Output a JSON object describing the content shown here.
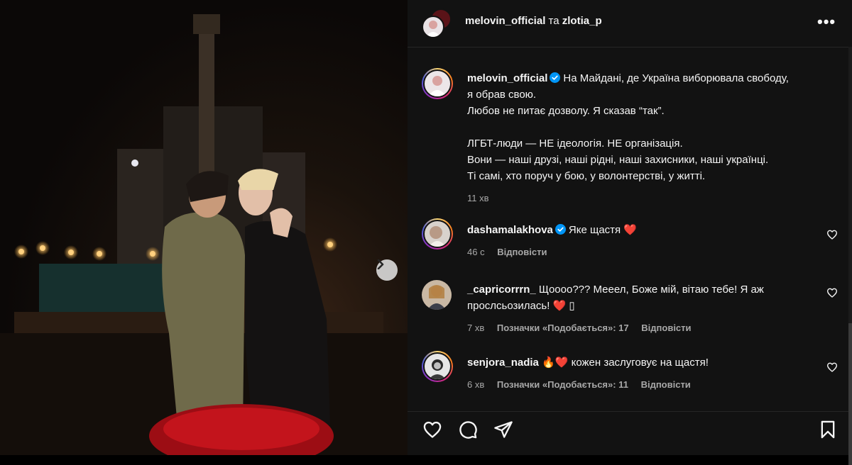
{
  "header": {
    "user1": "melovin_official",
    "joiner": "та",
    "user2": "zlotia_p"
  },
  "post": {
    "username": "melovin_official",
    "caption_lines": [
      "На Майдані, де Україна виборювала свободу,",
      "я обрав свою.",
      "Любов не питає дозволу. Я сказав “так”.",
      "",
      "ЛГБТ-люди — НЕ ідеологія. НЕ організація.",
      "Вони — наші друзі, наші рідні, наші захисники, наші українці.",
      "Ті самі, хто поруч у бою, у волонтерстві, у житті."
    ],
    "time": "11 хв"
  },
  "comments": [
    {
      "username": "dashamalakhova",
      "verified": true,
      "text": "Яке щастя",
      "emoji": "❤️",
      "time": "46 с",
      "likes": "",
      "reply": "Відповісти"
    },
    {
      "username": "_capricorrrn_",
      "verified": false,
      "text": "Щоооо??? Мееел, Боже мій, вітаю тебе! Я аж",
      "text2": "прослсьозилась! ❤️ ▯",
      "time": "7 хв",
      "likes": "Позначки «Подобається»: 17",
      "reply": "Відповісти"
    },
    {
      "username": "senjora_nadia",
      "verified": false,
      "text": "🔥❤️ кожен заслуговує на щастя!",
      "time": "6 хв",
      "likes": "Позначки «Подобається»: 11",
      "reply": "Відповісти"
    }
  ],
  "icons": [
    "more-options-icon",
    "verified-badge-icon",
    "heart-icon",
    "comment-icon",
    "share-icon",
    "bookmark-icon",
    "chevron-right-icon"
  ],
  "colors": {
    "verified": "#0095f6",
    "heart": "#ff3040",
    "panel_bg": "#121212",
    "muted": "#a8a8a8"
  }
}
